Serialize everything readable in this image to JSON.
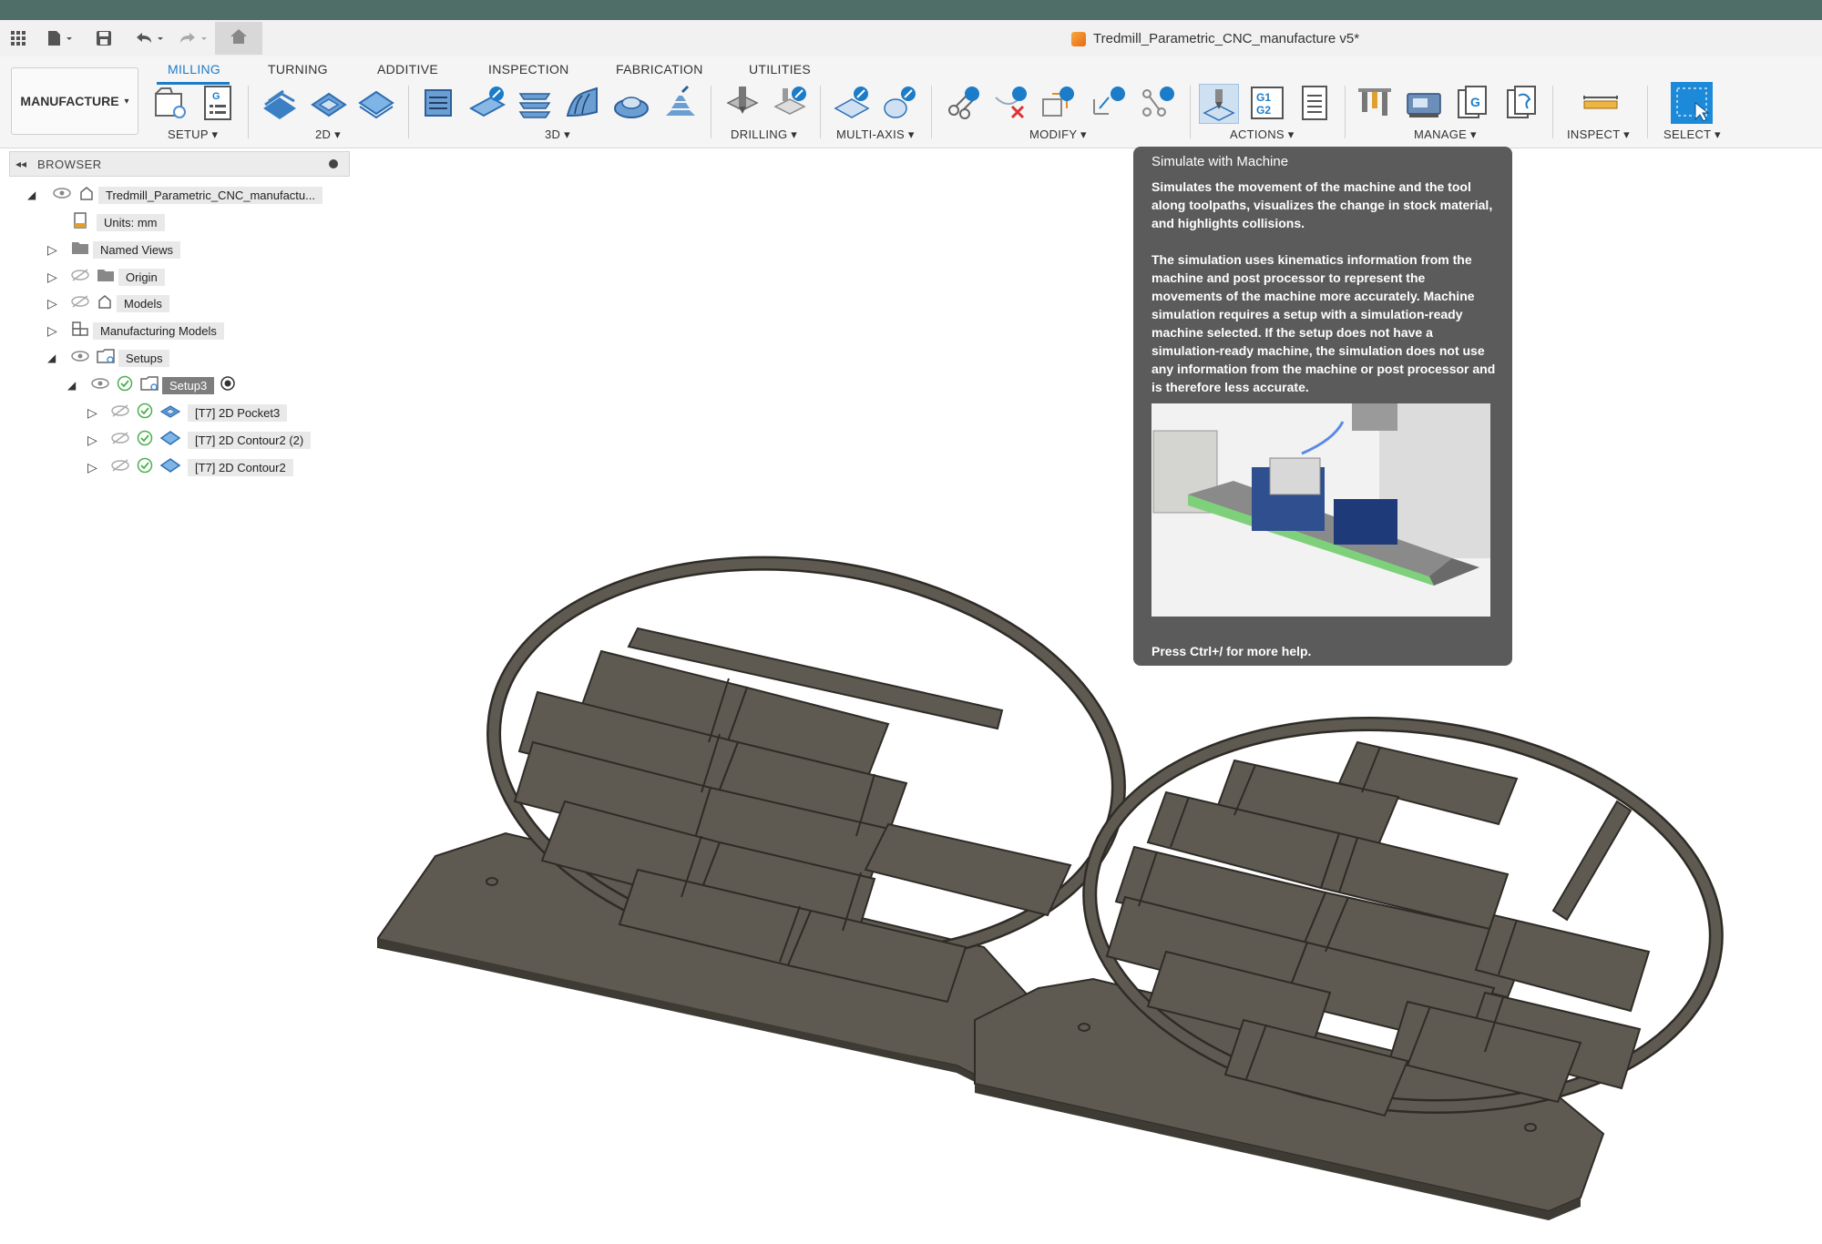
{
  "document": {
    "title": "Tredmill_Parametric_CNC_manufacture v5*"
  },
  "workspace": {
    "label": "MANUFACTURE"
  },
  "tabs": [
    "MILLING",
    "TURNING",
    "ADDITIVE",
    "INSPECTION",
    "FABRICATION",
    "UTILITIES"
  ],
  "active_tab": "MILLING",
  "groups": {
    "setup": "SETUP ▾",
    "two_d": "2D ▾",
    "three_d": "3D ▾",
    "drilling": "DRILLING ▾",
    "multi_axis": "MULTI-AXIS ▾",
    "modify": "MODIFY ▾",
    "actions": "ACTIONS ▾",
    "manage": "MANAGE ▾",
    "inspect": "INSPECT ▾",
    "select": "SELECT ▾"
  },
  "browser": {
    "title": "BROWSER",
    "root": "Tredmill_Parametric_CNC_manufactu...",
    "units": "Units: mm",
    "named_views": "Named Views",
    "origin": "Origin",
    "models": "Models",
    "manufacturing_models": "Manufacturing Models",
    "setups": "Setups",
    "setup3": "Setup3",
    "ops": [
      "[T7] 2D Pocket3",
      "[T7] 2D Contour2 (2)",
      "[T7] 2D Contour2"
    ]
  },
  "tooltip": {
    "title": "Simulate with Machine",
    "para1": "Simulates the movement of the machine and the tool along toolpaths, visualizes the change in stock material, and highlights collisions.",
    "para2": "The simulation uses kinematics information from the machine and post processor to represent the movements of the machine more accurately. Machine simulation requires a setup with a simulation-ready machine selected. If the setup does not have a simulation-ready machine, the simulation does not use any information from the machine or post processor and is therefore less accurate.",
    "footer": "Press Ctrl+/ for more help."
  },
  "colors": {
    "accent": "#1c7cc8",
    "part": "#5e5a52",
    "part_edge": "#2f2c27",
    "tooltip_bg": "#5b5b5b"
  },
  "icons": [
    "grid-icon",
    "file-icon",
    "save-icon",
    "undo-icon",
    "redo-icon",
    "home-icon",
    "eye-icon",
    "eye-hidden-icon",
    "check-icon",
    "folder-icon",
    "component-icon"
  ]
}
